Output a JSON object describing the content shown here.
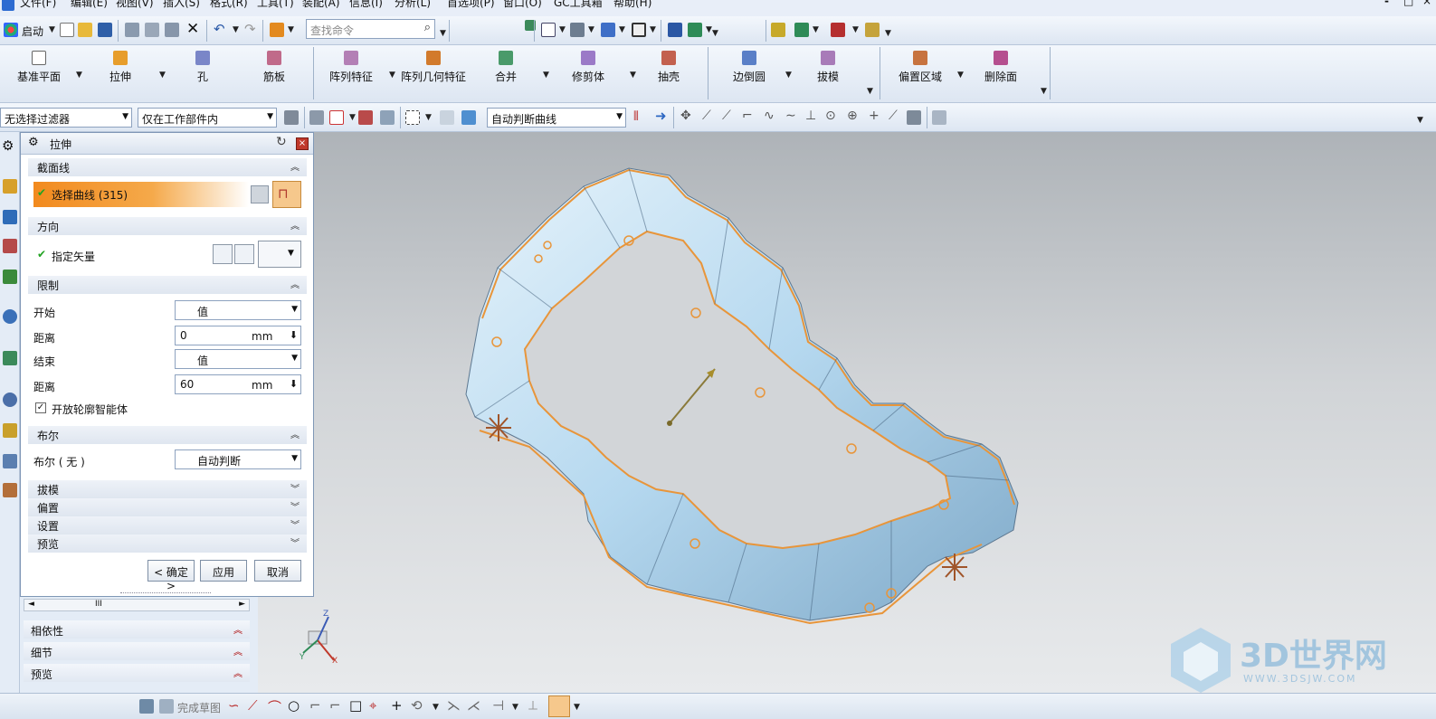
{
  "menu": {
    "items": [
      "文件(F)",
      "编辑(E)",
      "视图(V)",
      "插入(S)",
      "格式(R)",
      "工具(T)",
      "装配(A)",
      "信息(I)",
      "分析(L)",
      "首选项(P)",
      "窗口(O)",
      "GC工具箱",
      "帮助(H)"
    ],
    "window_controls": [
      "-",
      "□",
      "×"
    ]
  },
  "toolbar1": {
    "start_label": "启动",
    "search_placeholder": "查找命令"
  },
  "features": {
    "items": [
      "基准平面",
      "拉伸",
      "孔",
      "筋板",
      "阵列特征",
      "阵列几何特征",
      "合并",
      "修剪体",
      "抽壳",
      "边倒圆",
      "拔模",
      "偏置区域",
      "删除面"
    ]
  },
  "selection_bar": {
    "filter": "无选择过滤器",
    "scope": "仅在工作部件内",
    "curve_rule": "自动判断曲线"
  },
  "dialog": {
    "title": "拉伸",
    "sections": {
      "section_curve": "截面线",
      "direction": "方向",
      "limits": "限制",
      "boolean": "布尔",
      "draft": "拔模",
      "offset": "偏置",
      "settings": "设置",
      "preview": "预览"
    },
    "select_curve_label": "选择曲线 (315)",
    "specify_vector_label": "指定矢量",
    "start_label": "开始",
    "start_value": "值",
    "distance_label": "距离",
    "start_distance": "0",
    "end_label": "结束",
    "end_value": "值",
    "end_distance": "60",
    "unit": "mm",
    "open_profile_label": "开放轮廓智能体",
    "boolean_label": "布尔 ( 无 )",
    "boolean_value": "自动判断",
    "ok_label": "< 确定 >",
    "apply_label": "应用",
    "cancel_label": "取消"
  },
  "navigator": {
    "scroll_marker": "III",
    "rows": [
      "相依性",
      "细节",
      "预览"
    ]
  },
  "triad": {
    "x": "X",
    "y": "Y",
    "z": "Z"
  },
  "statusbar": {
    "finish_sketch_label": "完成草图"
  },
  "watermark": {
    "text": "3D世界网",
    "subtext": "WWW.3DSJW.COM"
  },
  "colors": {
    "part_fill": "#b9daf0",
    "edge_highlight": "#e8953a",
    "dialog_highlight": "#f28a1e",
    "close_button": "#c0392b"
  }
}
